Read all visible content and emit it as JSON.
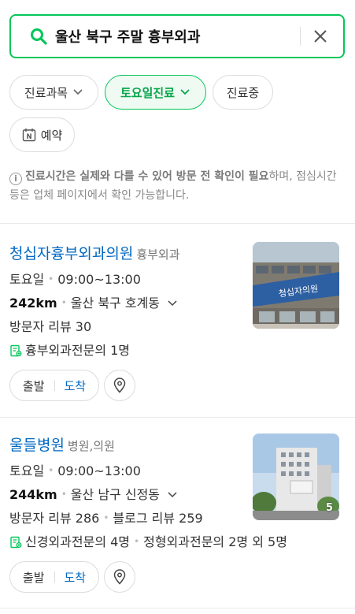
{
  "search": {
    "query": "울산 북구 주말 흉부외과"
  },
  "filters": [
    {
      "label": "진료과목",
      "active": false
    },
    {
      "label": "토요일진료",
      "active": true
    },
    {
      "label": "진료중",
      "active": false
    },
    {
      "label": "예약",
      "active": false,
      "icon": "naver-booking-icon"
    }
  ],
  "notice": {
    "bold": "진료시간은 실제와 다를 수 있어 방문 전 확인이 필요",
    "rest": "하며, 점심시간 등은 업체 페이지에서 확인 가능합니다."
  },
  "results": [
    {
      "name": "청십자흉부외과의원",
      "category": "흉부외과",
      "day": "토요일",
      "hours": "09:00~13:00",
      "distance": "242km",
      "address": "울산 북구 호계동",
      "reviews": [
        "방문자 리뷰 30"
      ],
      "specialists": [
        "흉부외과전문의 1명"
      ],
      "photo_count": ""
    },
    {
      "name": "울들병원",
      "category": "병원,의원",
      "day": "토요일",
      "hours": "09:00~13:00",
      "distance": "244km",
      "address": "울산 남구 신정동",
      "reviews": [
        "방문자 리뷰 286",
        "블로그 리뷰 259"
      ],
      "specialists": [
        "신경외과전문의 4명",
        "정형외과전문의 2명 외 5명"
      ],
      "photo_count": "5"
    }
  ],
  "route": {
    "depart": "출발",
    "arrive": "도착"
  },
  "colors": {
    "accent": "#03c75a",
    "link": "#0068c3"
  }
}
